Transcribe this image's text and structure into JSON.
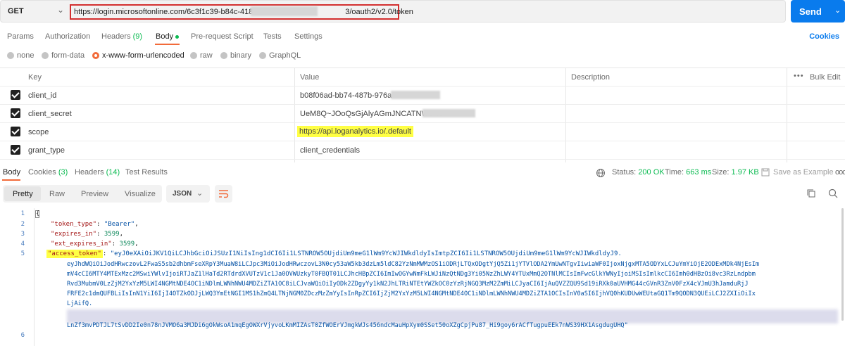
{
  "request": {
    "method": "GET",
    "url_start": "https://login.microsoftonline.com/6c3f1c39-b84c-4188-b49f-",
    "url_end": "3/oauth2/v2.0/token",
    "send_label": "Send"
  },
  "request_tabs": {
    "params": "Params",
    "authorization": "Authorization",
    "headers": "Headers",
    "headers_count": "(9)",
    "body": "Body",
    "pre_request": "Pre-request Script",
    "tests": "Tests",
    "settings": "Settings",
    "cookies": "Cookies"
  },
  "body_types": [
    "none",
    "form-data",
    "x-www-form-urlencoded",
    "raw",
    "binary",
    "GraphQL"
  ],
  "body_type_selected": "x-www-form-urlencoded",
  "params_table": {
    "headers": {
      "key": "Key",
      "value": "Value",
      "description": "Description",
      "bulk_edit": "Bulk Edit",
      "more": "•••"
    },
    "rows": [
      {
        "key": "client_id",
        "value": "b08f06ad-bb74-487b-976a",
        "checked": true
      },
      {
        "key": "client_secret",
        "value": "UeM8Q~JOoQsGjAlyAGmJNCATNW5H6",
        "checked": true
      },
      {
        "key": "scope",
        "value": "https://api.loganalytics.io/.default",
        "checked": true
      },
      {
        "key": "grant_type",
        "value": "client_credentials",
        "checked": true
      }
    ]
  },
  "response_tabs": {
    "body": "Body",
    "cookies": "Cookies",
    "cookies_count": "(3)",
    "headers": "Headers",
    "headers_count": "(14)",
    "test_results": "Test Results"
  },
  "status": {
    "status_label": "Status:",
    "status_value": "200 OK",
    "time_label": "Time:",
    "time_value": "663 ms",
    "size_label": "Size:",
    "size_value": "1.97 KB",
    "save_example": "Save as Example",
    "more": "ooo"
  },
  "view_modes": [
    "Pretty",
    "Raw",
    "Preview",
    "Visualize"
  ],
  "format": "JSON",
  "code": {
    "line_numbers": [
      "1",
      "2",
      "3",
      "4",
      "5",
      "6"
    ],
    "open_brace": "{",
    "line2_key": "\"token_type\"",
    "line2_val": "\"Bearer\"",
    "line3_key": "\"expires_in\"",
    "line3_val": "3599",
    "line4_key": "\"ext_expires_in\"",
    "line4_val": "3599",
    "line5_key": "\"access_token\"",
    "token_lines": [
      "\"eyJ0eXAiOiJKV1QiLCJhbGciOiJSUzI1NiIsIng1dCI6Ii1LSTNROW5OUjdiUm9meG1lWm9YcWJIWkdldyIsImtpZCI6Ii1LSTNROW5OUjdiUm9meG1lWm9YcWJIWkdldyJ9.",
      "eyJhdWQiOiJodHRwczovL2FwaS5sb2dhbmFseXRpY3MuaW8iLCJpc3MiOiJodHRwczovL3N0cy53aW5kb3dzLm5ldC82YzNmMWMzOS1iODRjLTQxODgtYjQ5Zi1jYTVlODA2YmUwNTgvIiwiaWF0IjoxNjgxMTA5ODYxLCJuYmYiOjE2ODExMDk4NjEsIm",
      "mV4cCI6MTY4MTExMzc2MSwiYWlvIjoiRTJaZ1lHaTd2RTdrdXVUTzV1c1Ja0OVWUzkyT0FBQT01LCJhcHBpZCI6ImIwOGYwNmFkLWJiNzQtNDg3Yi05NzZhLWY4YTUxMmQ2OTNlMCIsImFwcGlkYWNyIjoiMSIsImlkcCI6Imh0dHBzOi8vc3RzLndpbm",
      "Rvd3MubmV0LzZjM2YxYzM5LWI4NGMtNDE4OC1iNDlmLWNhNWU4MDZiZTA1OC8iLCJvaWQiOiIyODk2ZDgyYy1kN2JhLTRiNTEtYWZkOC0zYzRjNGQ3MzM2ZmMiLCJyaCI6IjAuQVZZQU9Sd19iRXk0aUVHMG44cGVnR3ZnV0FzX4cVJmU3hJamduRjJ",
      "FRFE2c1dmQUFBLiIsInN1YiI6IjI4OTZkODJjLWQ3YmEtNGI1MS1hZmQ4LTNjNGM0ZDczMzZmYyIsInRpZCI6IjZjM2YxYzM5LWI4NGMtNDE4OC1iNDlmLWNhNWU4MDZiZTA1OCIsInV0aSI6IjhVQ0hKUDUwWEUtaGQ1Tm9QODN3QUEiLCJ2ZXIiOiIx",
      "LjAifQ.",
      "LnZf3mvPDTJL7tSvDD2Ie0n78nJVMO6a3MJDi6gOkWsoA1mqEgOWXrVjyvoLKmMIZAsT0ZfWOErVJmgkWJs456ndcMauHpXym0SSet50oXZgCpjPu87_Hi9goy6rACfTugpuEEk7nWS39HX1AsgdugUHQ\""
    ]
  }
}
